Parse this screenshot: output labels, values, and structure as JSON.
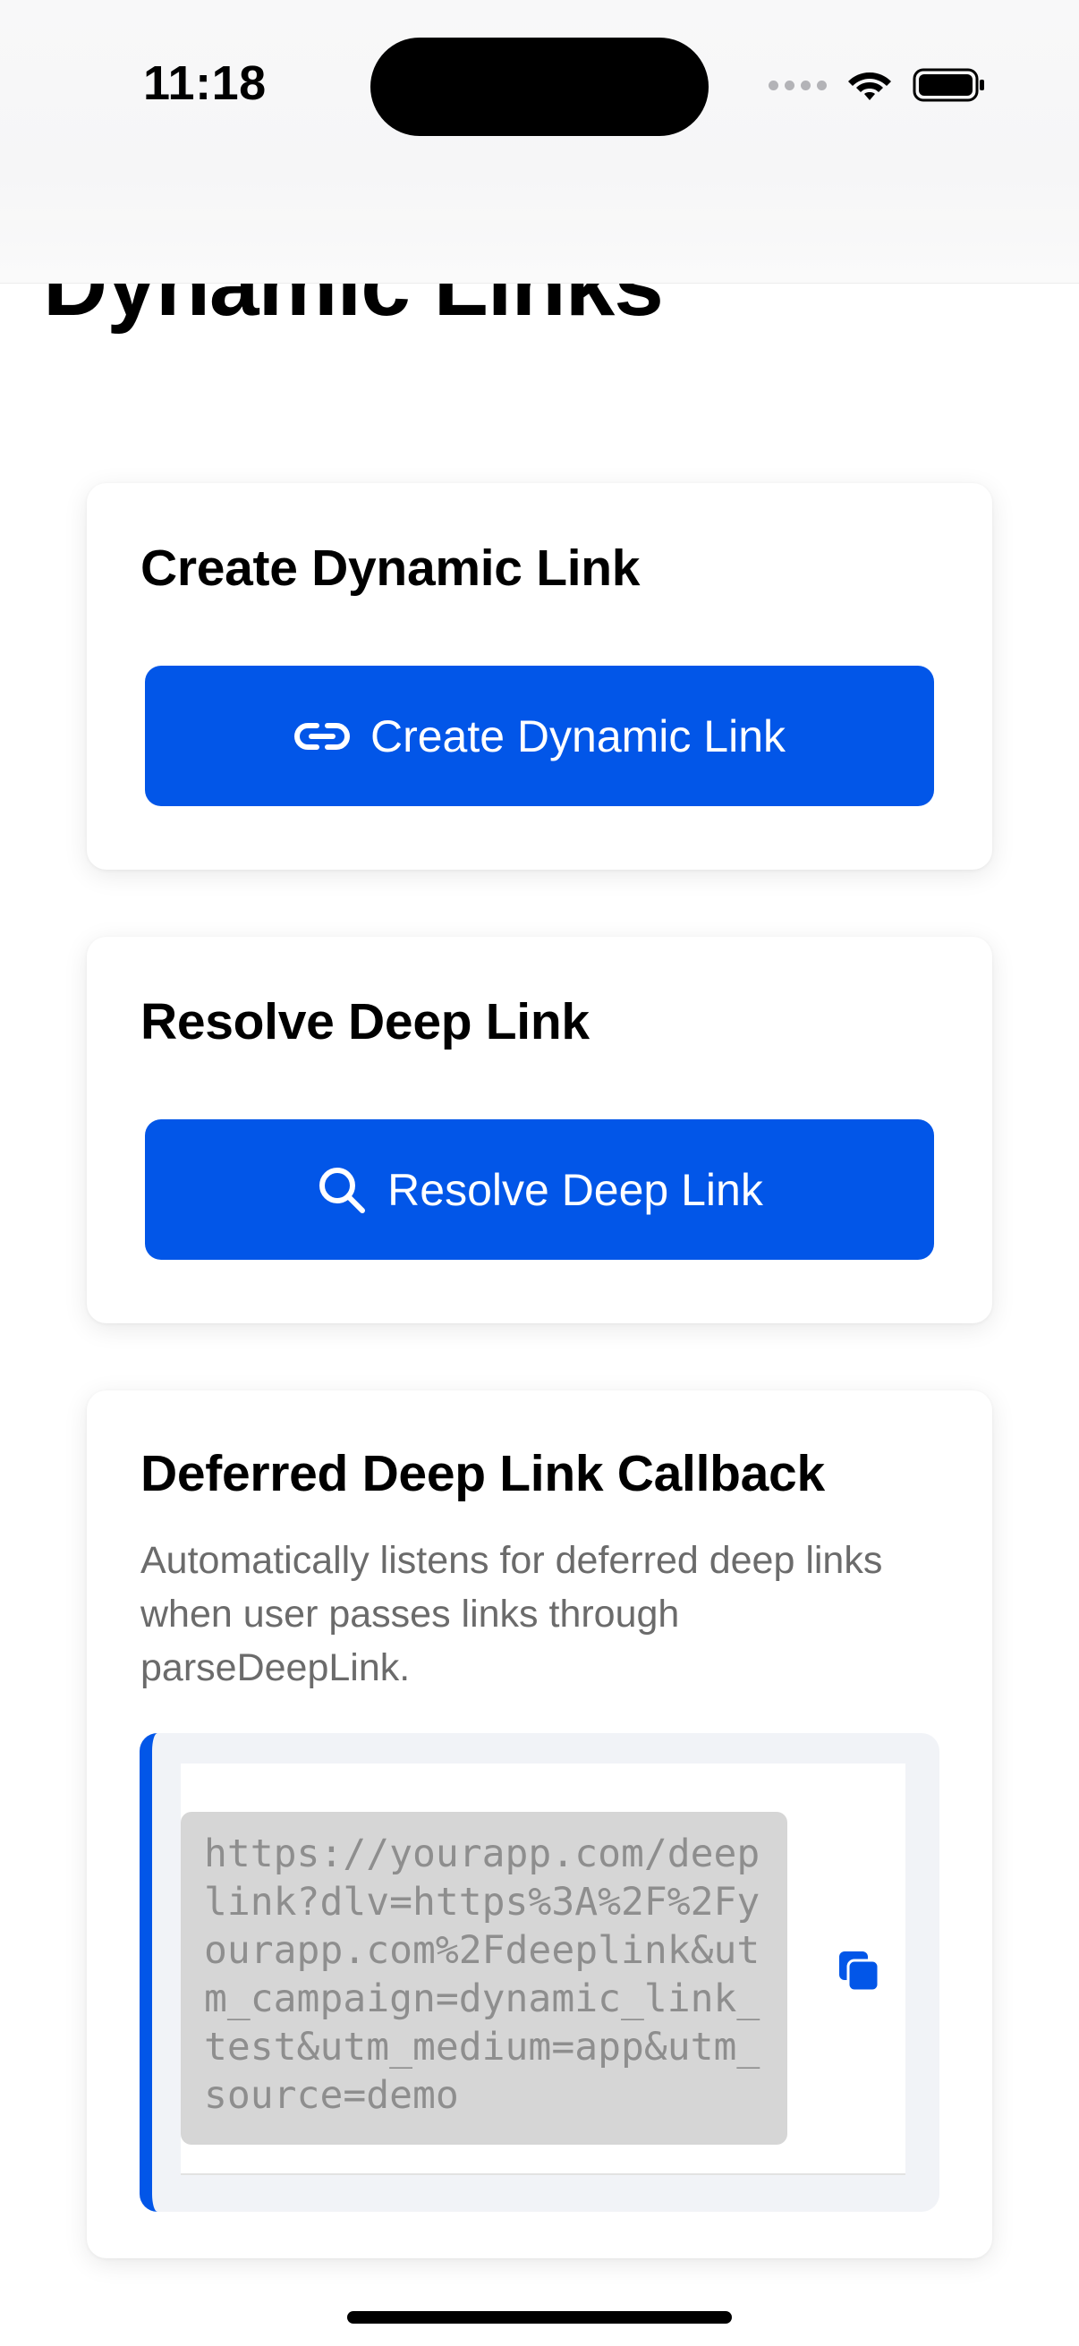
{
  "status_bar": {
    "time": "11:18"
  },
  "page": {
    "title": "Dynamic Links"
  },
  "create_card": {
    "title": "Create Dynamic Link",
    "button_label": "Create Dynamic Link",
    "button_icon": "link-icon"
  },
  "resolve_card": {
    "title": "Resolve Deep Link",
    "button_label": "Resolve Deep Link",
    "button_icon": "search-icon"
  },
  "deferred_card": {
    "title": "Deferred Deep Link Callback",
    "description": "Automatically listens for deferred deep links when user passes links through parseDeepLink.",
    "link_value": "https://yourapp.com/deeplink?dlv=https%3A%2F%2Fyourapp.com%2Fdeeplink&utm_campaign=dynamic_link_test&utm_medium=app&utm_source=demo",
    "copy_icon": "copy-icon"
  },
  "colors": {
    "accent": "#0256e8",
    "muted_text": "#6b6b6b",
    "code_background": "#d6d6d6"
  }
}
